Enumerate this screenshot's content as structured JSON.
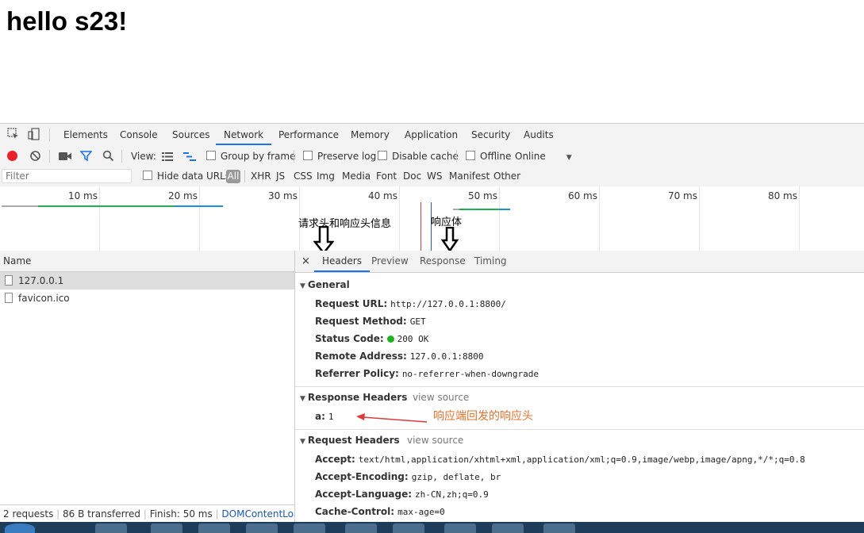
{
  "page": {
    "heading": "hello s23!"
  },
  "devtools": {
    "tabs": [
      "Elements",
      "Console",
      "Sources",
      "Network",
      "Performance",
      "Memory",
      "Application",
      "Security",
      "Audits"
    ],
    "active_tab": "Network",
    "toolbar": {
      "view_label": "View:",
      "group_by_frame": "Group by frame",
      "preserve_log": "Preserve log",
      "disable_cache": "Disable cache",
      "offline": "Offline",
      "throttle": "Online"
    },
    "filter": {
      "placeholder": "Filter",
      "hide_data_urls": "Hide data URLs",
      "all": "All",
      "types": [
        "XHR",
        "JS",
        "CSS",
        "Img",
        "Media",
        "Font",
        "Doc",
        "WS",
        "Manifest",
        "Other"
      ]
    },
    "timeline": {
      "ticks": [
        "10 ms",
        "20 ms",
        "30 ms",
        "40 ms",
        "50 ms",
        "60 ms",
        "70 ms",
        "80 ms"
      ]
    },
    "annotations": {
      "headers_note": "请求头和响应头信息",
      "body_note": "响应体",
      "response_header_note": "响应端回发的响应头"
    },
    "requests": {
      "column": "Name",
      "items": [
        "127.0.0.1",
        "favicon.ico"
      ]
    },
    "status_bar": {
      "requests": "2 requests",
      "transferred": "86 B transferred",
      "finish": "Finish: 50 ms",
      "dom": "DOMContentLoade..."
    },
    "detail": {
      "close": "×",
      "tabs": [
        "Headers",
        "Preview",
        "Response",
        "Timing"
      ],
      "active_tab": "Headers",
      "general": {
        "title": "General",
        "request_url_k": "Request URL:",
        "request_url_v": "http://127.0.0.1:8800/",
        "method_k": "Request Method:",
        "method_v": "GET",
        "status_k": "Status Code:",
        "status_v": "200 OK",
        "remote_k": "Remote Address:",
        "remote_v": "127.0.0.1:8800",
        "referrer_k": "Referrer Policy:",
        "referrer_v": "no-referrer-when-downgrade"
      },
      "response_headers": {
        "title": "Response Headers",
        "view_source": "view source",
        "a_k": "a:",
        "a_v": "1"
      },
      "request_headers": {
        "title": "Request Headers",
        "view_source": "view source",
        "accept_k": "Accept:",
        "accept_v": "text/html,application/xhtml+xml,application/xml;q=0.9,image/webp,image/apng,*/*;q=0.8",
        "encoding_k": "Accept-Encoding:",
        "encoding_v": "gzip, deflate, br",
        "language_k": "Accept-Language:",
        "language_v": "zh-CN,zh;q=0.9",
        "cache_k": "Cache-Control:",
        "cache_v": "max-age=0"
      }
    }
  },
  "colors": {
    "accent": "#1a73e8",
    "record": "#e8222a",
    "status_ok": "#1db31d",
    "annotation": "#e8702a"
  }
}
